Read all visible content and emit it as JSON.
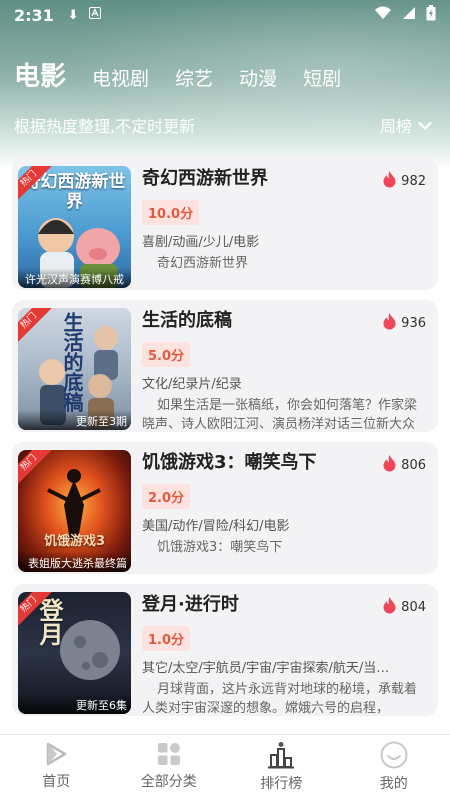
{
  "status_bar": {
    "time": "2:31"
  },
  "nav": {
    "tabs": [
      "电影",
      "电视剧",
      "综艺",
      "动漫",
      "短剧"
    ],
    "active_index": 0
  },
  "subheader": {
    "description": "根据热度整理,不定时更新",
    "ranking_period": "周榜"
  },
  "items": [
    {
      "title": "奇幻西游新世界",
      "heat": "982",
      "score": "10.0分",
      "tags": "喜剧/动画/少儿/电影",
      "description": "奇幻西游新世界",
      "ribbon": "热门",
      "poster_title": "奇幻西游新世界",
      "poster_caption": "许光汉声演赛博八戒"
    },
    {
      "title": "生活的底稿",
      "heat": "936",
      "score": "5.0分",
      "tags": "文化/纪录片/纪录",
      "description": "如果生活是一张稿纸，你会如何落笔？作家梁晓声、诗人欧阳江河、演员杨洋对话三位新大众文艺创作者，一起看“生活的底稿由平…",
      "ribbon": "热门",
      "poster_title": "生活的底稿",
      "poster_caption": "更新至3期"
    },
    {
      "title": "饥饿游戏3：嘲笑鸟下",
      "heat": "806",
      "score": "2.0分",
      "tags": "美国/动作/冒险/科幻/电影",
      "description": "饥饿游戏3：嘲笑鸟下",
      "ribbon": "热门",
      "poster_title": "饥饿游戏3",
      "poster_caption": "表姐版大逃杀最终篇"
    },
    {
      "title": "登月·进行时",
      "heat": "804",
      "score": "1.0分",
      "tags": "其它/太空/宇航员/宇宙/宇宙探索/航天/当…",
      "description": "月球背面，这片永远背对地球的秘境，承载着人类对宇宙深邃的想象。嫦娥六号的启程，",
      "ribbon": "热门",
      "poster_title": "登月",
      "poster_caption": "更新至6集"
    }
  ],
  "tabbar": {
    "items": [
      {
        "label": "首页",
        "icon": "play-icon"
      },
      {
        "label": "全部分类",
        "icon": "grid-icon"
      },
      {
        "label": "排行榜",
        "icon": "ranking-icon"
      },
      {
        "label": "我的",
        "icon": "smile-icon"
      }
    ],
    "active_index": 2
  },
  "colors": {
    "heat_flame": "#f0465a",
    "score_bg": "#fde3df",
    "score_text": "#e25a3f",
    "ribbon": "#e53935"
  }
}
